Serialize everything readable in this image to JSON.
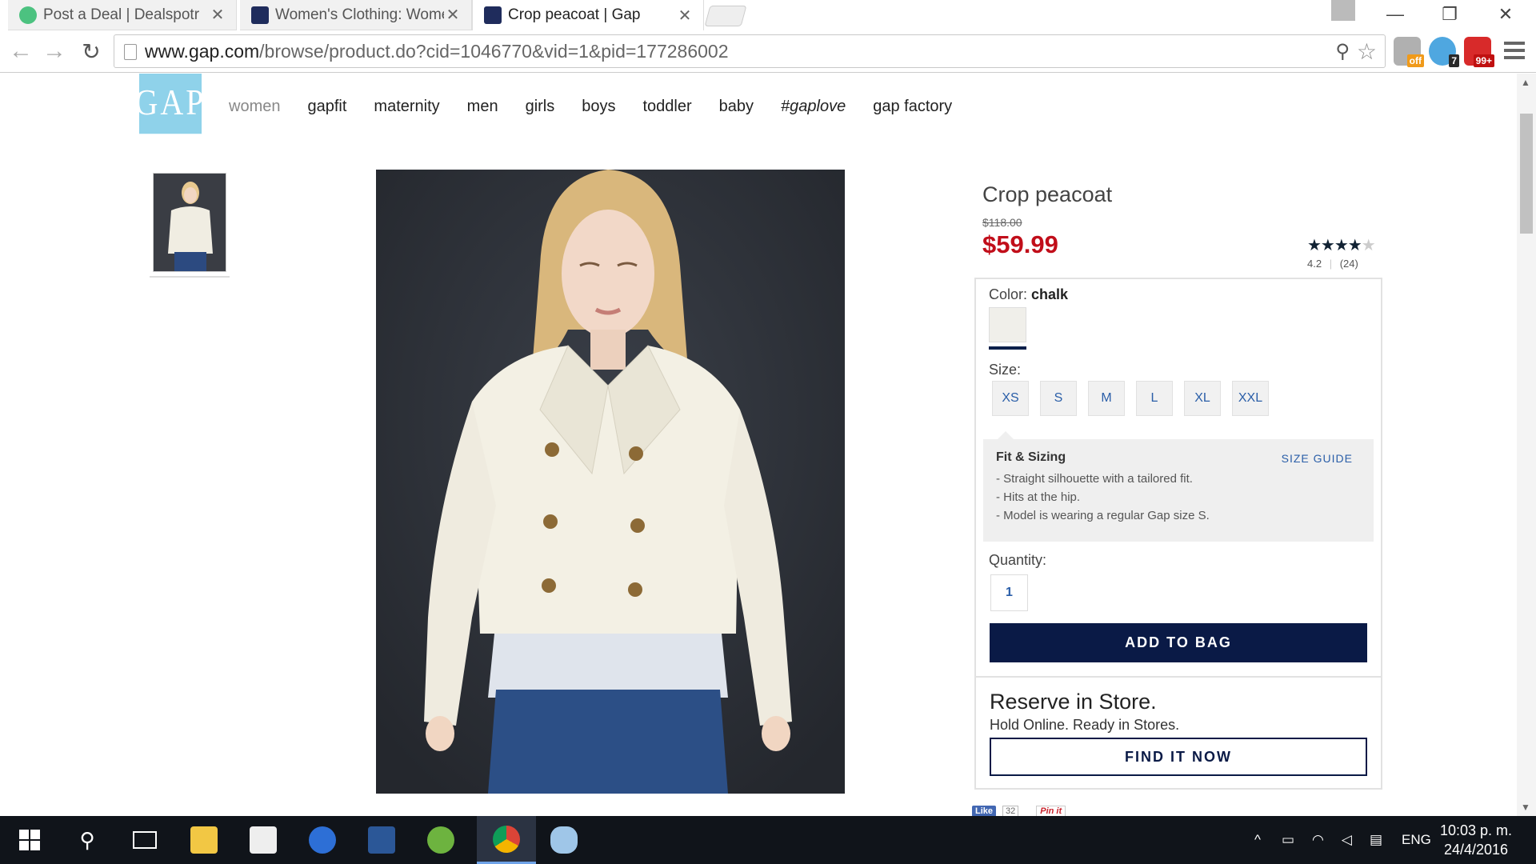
{
  "browser": {
    "tabs": [
      {
        "title": "Post a Deal | Dealspotr",
        "active": false
      },
      {
        "title": "Women's Clothing: Women",
        "active": false
      },
      {
        "title": "Crop peacoat | Gap",
        "active": true
      }
    ],
    "url_domain": "www.gap.com",
    "url_path": "/browse/product.do?cid=1046770&vid=1&pid=177286002",
    "ext_badges": [
      "off",
      "7",
      "99+"
    ]
  },
  "site": {
    "logo": "GAP",
    "nav": [
      "women",
      "gapfit",
      "maternity",
      "men",
      "girls",
      "boys",
      "toddler",
      "baby",
      "#gaplove",
      "gap factory"
    ]
  },
  "product": {
    "name": "Crop peacoat",
    "old_price": "$118.00",
    "price": "$59.99",
    "stars_filled": "★★★★",
    "stars_empty": "★",
    "rating": "4.2",
    "reviews": "(24)",
    "color_label": "Color:",
    "color_value": "chalk",
    "size_label": "Size:",
    "sizes": [
      "XS",
      "S",
      "M",
      "L",
      "XL",
      "XXL"
    ],
    "fit_title": "Fit & Sizing",
    "size_guide": "SIZE GUIDE",
    "fit_notes": [
      "- Straight silhouette with a tailored fit.",
      "- Hits at the hip.",
      "- Model is wearing a regular Gap size S."
    ],
    "quantity_label": "Quantity:",
    "quantity": "1",
    "add_to_bag": "ADD TO BAG",
    "reserve_title": "Reserve in Store.",
    "reserve_sub": "Hold Online. Ready in Stores.",
    "find_it_now": "FIND IT NOW"
  },
  "social": {
    "like": "Like",
    "like_count": "32",
    "pin": "Pin it"
  },
  "taskbar": {
    "lang": "ENG",
    "time": "10:03 p. m.",
    "date": "24/4/2016"
  }
}
